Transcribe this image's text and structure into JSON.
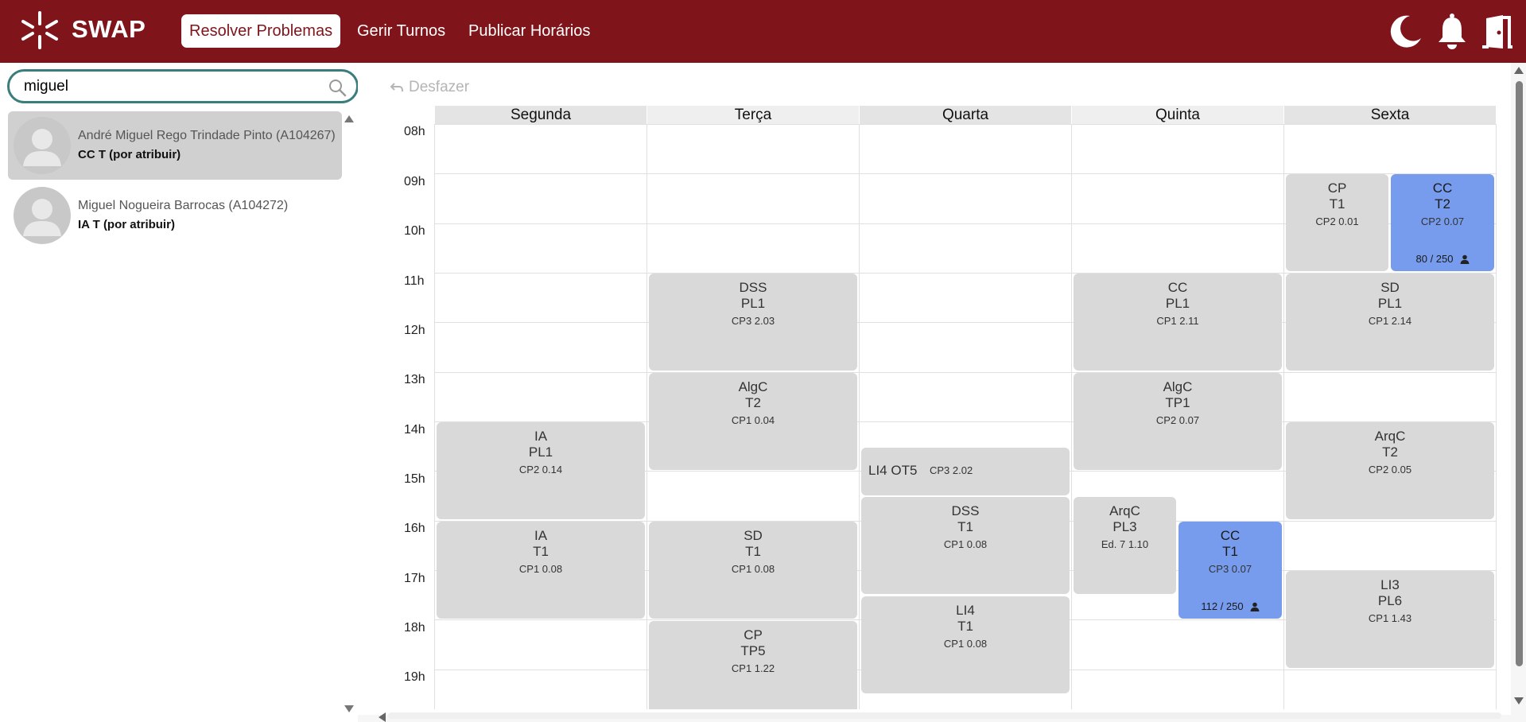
{
  "header": {
    "brand": "SWAP",
    "nav": [
      {
        "label": "Resolver Problemas",
        "active": true
      },
      {
        "label": "Gerir Turnos",
        "active": false
      },
      {
        "label": "Publicar Horários",
        "active": false
      }
    ],
    "icons": [
      "moon-icon",
      "bell-icon",
      "logout-door-icon"
    ],
    "color": "#7f151b"
  },
  "sidebar": {
    "search": {
      "value": "miguel",
      "placeholder": ""
    },
    "students": [
      {
        "name": "André Miguel Rego Trindade Pinto (A104267)",
        "sub": "CC T (por atribuir)",
        "selected": true
      },
      {
        "name": "Miguel Nogueira Barrocas (A104272)",
        "sub": "IA T (por atribuir)",
        "selected": false
      }
    ]
  },
  "main": {
    "undo_label": "Desfazer",
    "days": [
      "Segunda",
      "Terça",
      "Quarta",
      "Quinta",
      "Sexta"
    ],
    "hours": [
      "08h",
      "09h",
      "10h",
      "11h",
      "12h",
      "13h",
      "14h",
      "15h",
      "16h",
      "17h",
      "18h",
      "19h"
    ],
    "blocks": [
      {
        "code": "IA",
        "type": "PL1",
        "room": "CP2 0.14"
      },
      {
        "code": "IA",
        "type": "T1",
        "room": "CP1 0.08"
      },
      {
        "code": "DSS",
        "type": "PL1",
        "room": "CP3 2.03"
      },
      {
        "code": "AlgC",
        "type": "T2",
        "room": "CP1 0.04"
      },
      {
        "code": "SD",
        "type": "T1",
        "room": "CP1 0.08"
      },
      {
        "code": "CP",
        "type": "TP5",
        "room": "CP1 1.22"
      },
      {
        "code": "LI4 OT5",
        "room": "CP3 2.02"
      },
      {
        "code": "DSS",
        "type": "T1",
        "room": "CP1 0.08"
      },
      {
        "code": "LI4",
        "type": "T1",
        "room": "CP1 0.08"
      },
      {
        "code": "CC",
        "type": "PL1",
        "room": "CP1 2.11"
      },
      {
        "code": "AlgC",
        "type": "TP1",
        "room": "CP2 0.07"
      },
      {
        "code": "ArqC",
        "type": "PL3",
        "room": "Ed. 7 1.10"
      },
      {
        "code": "CC",
        "type": "T1",
        "room": "CP3 0.07",
        "capacity": "112 / 250"
      },
      {
        "code": "CP",
        "type": "T1",
        "room": "CP2 0.01"
      },
      {
        "code": "CC",
        "type": "T2",
        "room": "CP2 0.07",
        "capacity": "80 / 250"
      },
      {
        "code": "SD",
        "type": "PL1",
        "room": "CP1 2.14"
      },
      {
        "code": "ArqC",
        "type": "T2",
        "room": "CP2 0.05"
      },
      {
        "code": "LI3",
        "type": "PL6",
        "room": "CP1 1.43"
      }
    ],
    "colors": {
      "block": "#d9d9d9",
      "highlight": "#779ced"
    }
  }
}
